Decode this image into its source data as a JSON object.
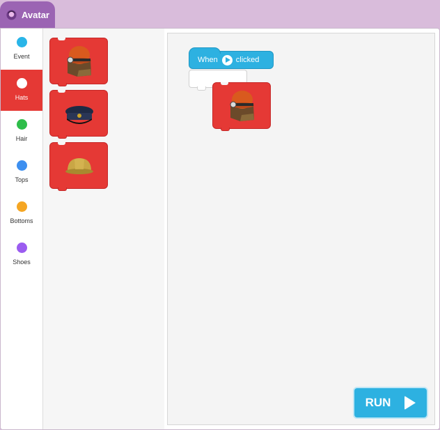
{
  "tab": {
    "title": "Avatar",
    "icon": "avatar-icon"
  },
  "categories": [
    {
      "label": "Event",
      "color": "#29b5e8"
    },
    {
      "label": "Hats",
      "color": "#ffffff",
      "active": true
    },
    {
      "label": "Hair",
      "color": "#2ebd4a"
    },
    {
      "label": "Tops",
      "color": "#3d8ff0"
    },
    {
      "label": "Bottoms",
      "color": "#f5a623"
    },
    {
      "label": "Shoes",
      "color": "#9b5cf0"
    }
  ],
  "palette_blocks": [
    {
      "icon": "miner-helmet-icon"
    },
    {
      "icon": "police-cap-icon"
    },
    {
      "icon": "hard-hat-icon"
    }
  ],
  "workspace": {
    "event_block": {
      "when": "When",
      "clicked": "clicked",
      "icon": "green-flag-icon"
    },
    "hat_block": {
      "icon": "miner-helmet-icon"
    }
  },
  "run_button": {
    "label": "RUN",
    "icon": "play-icon"
  },
  "colors": {
    "accent": "#9b64b3",
    "block_red": "#e53935",
    "event_blue": "#2db1e1"
  }
}
